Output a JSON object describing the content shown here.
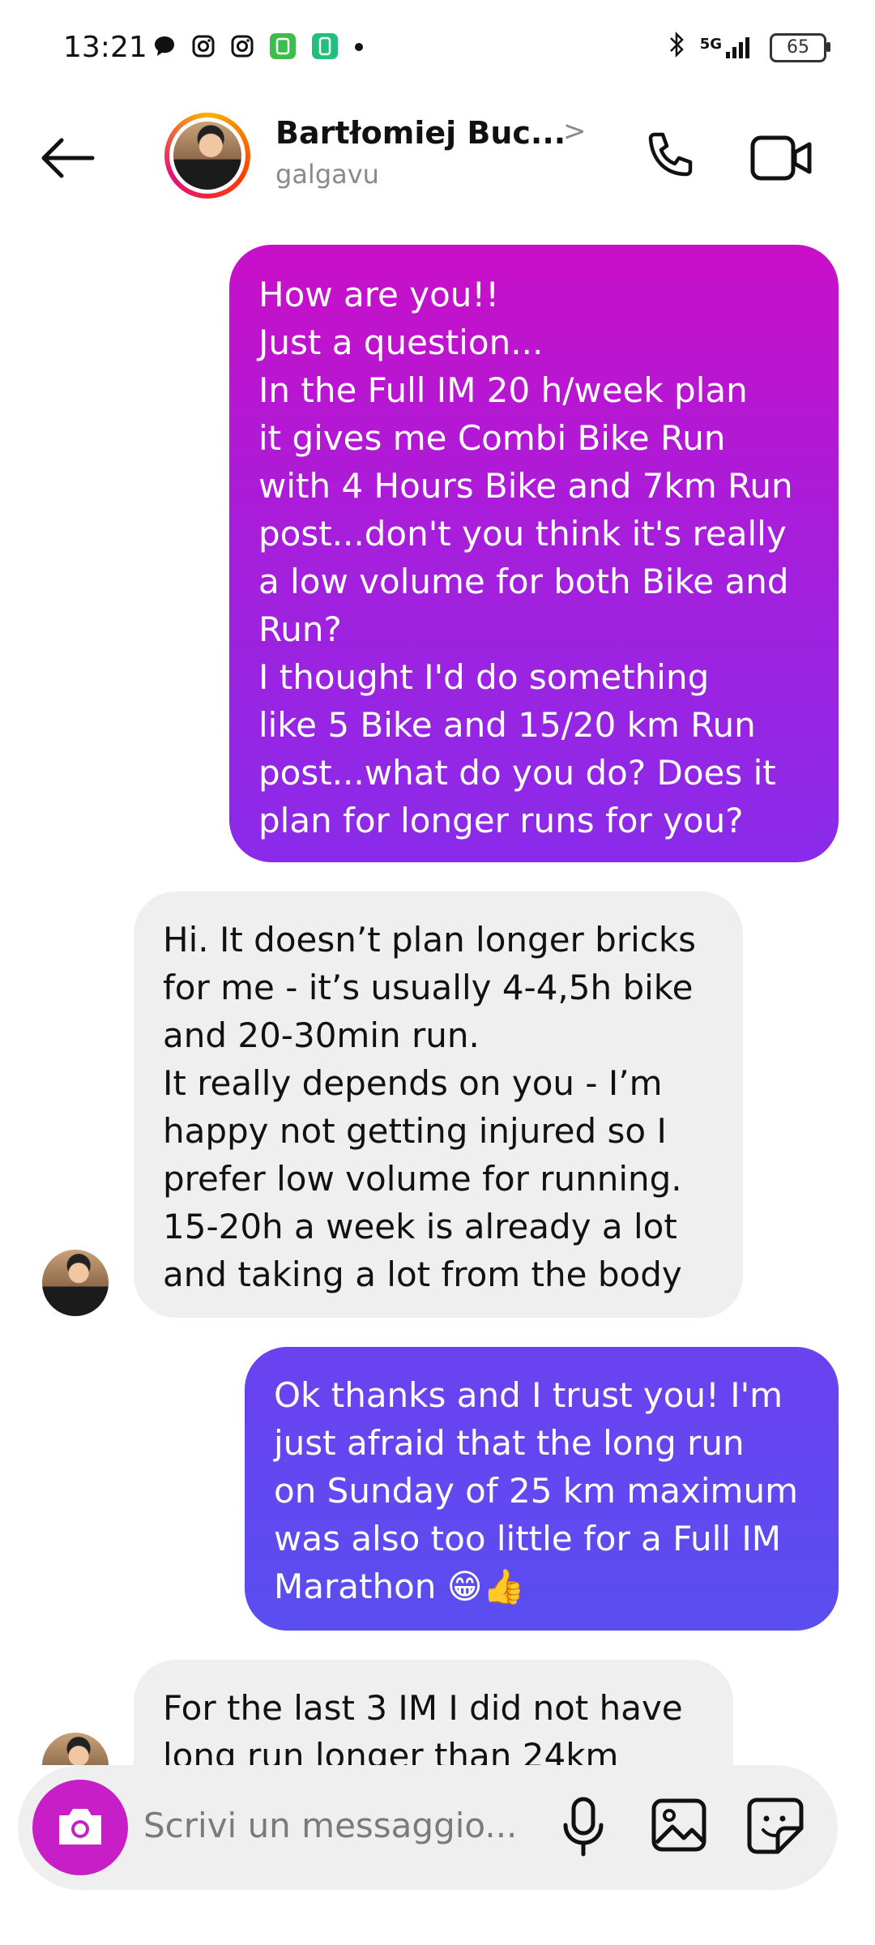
{
  "status_bar": {
    "time": "13:21",
    "network": "5G",
    "battery": "65",
    "notification_icons": [
      "chat-bubble-icon",
      "instagram-icon",
      "instagram-icon",
      "app-icon",
      "app-icon",
      "dot-icon"
    ]
  },
  "header": {
    "name": "Bartłomiej Buc...",
    "handle": "galgavu",
    "chevron": ">"
  },
  "messages": [
    {
      "from": "me",
      "text": "How are you!!\nJust a question...\nIn the Full IM 20 h/week plan\nit gives me Combi Bike Run\nwith 4 Hours Bike and 7km Run\npost...don't you think it's really\na low volume for both Bike and\nRun?\nI thought I'd do something\nlike 5 Bike and 15/20 km Run\npost...what do you do? Does it\nplan for longer runs for you?"
    },
    {
      "from": "them",
      "text": "Hi. It doesn’t plan longer bricks\nfor me - it’s usually 4-4,5h bike\nand 20-30min run.\nIt really depends on you - I’m\nhappy not getting injured so I\nprefer low volume for running.\n15-20h a week is already a lot\nand taking a lot from the body"
    },
    {
      "from": "me",
      "text": "Ok thanks and I trust you! I'm\njust afraid that the long run\non Sunday of 25 km maximum\nwas also too little for a Full IM\nMarathon 😁👍"
    },
    {
      "from": "them",
      "text": "For the last 3 IM I did not have\nlong run longer than 24km"
    }
  ],
  "composer": {
    "placeholder": "Scrivi un messaggio..."
  },
  "colors": {
    "sent_top": "#c90fc8",
    "sent_bottom": "#8a2bea",
    "sent_alt": "#5a4ef0",
    "received": "#efefef",
    "camera_button": "#c81ec8"
  }
}
